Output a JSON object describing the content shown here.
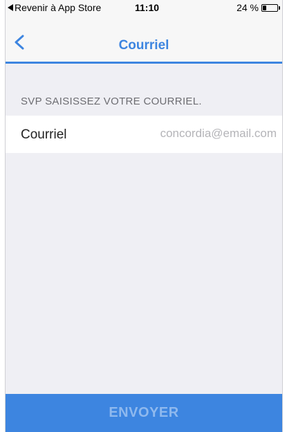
{
  "status_bar": {
    "back_app": "Revenir à App Store",
    "time": "11:10",
    "battery_text": "24 %",
    "battery_level": 0.24
  },
  "nav": {
    "title": "Courriel",
    "back_icon": "chevron-left-icon"
  },
  "form": {
    "section_header": "SVP SAISISSEZ VOTRE COURRIEL.",
    "email_label": "Courriel",
    "email_placeholder": "concordia@email.com",
    "email_value": ""
  },
  "submit": {
    "label": "ENVOYER"
  },
  "colors": {
    "accent": "#3d85e0",
    "background": "#efeff4",
    "disabled_text": "#8fb9ee"
  }
}
